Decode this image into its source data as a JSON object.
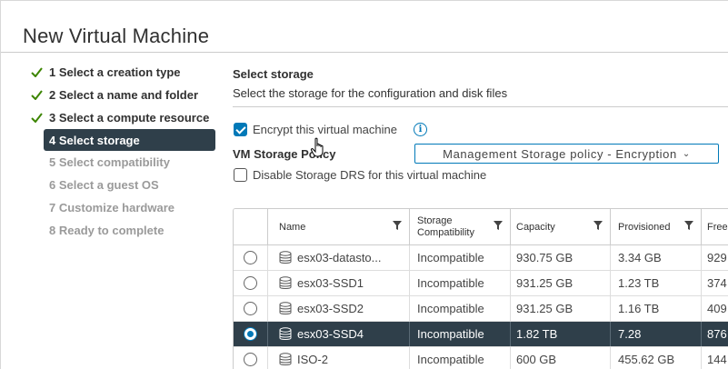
{
  "dialog": {
    "title": "New Virtual Machine"
  },
  "steps": [
    {
      "label": "1 Select a creation type",
      "state": "done"
    },
    {
      "label": "2 Select a name and folder",
      "state": "done"
    },
    {
      "label": "3 Select a compute resource",
      "state": "done"
    },
    {
      "label": "4 Select storage",
      "state": "active"
    },
    {
      "label": "5 Select compatibility",
      "state": "pending"
    },
    {
      "label": "6 Select a guest OS",
      "state": "pending"
    },
    {
      "label": "7 Customize hardware",
      "state": "pending"
    },
    {
      "label": "8 Ready to complete",
      "state": "pending"
    }
  ],
  "storage": {
    "title": "Select storage",
    "description": "Select the storage for the configuration and disk files",
    "encrypt_label": "Encrypt this virtual machine",
    "encrypt_checked": true,
    "policy_label": "VM Storage Policy",
    "policy_value": "Management Storage policy - Encryption",
    "disable_drs_label": "Disable Storage DRS for this virtual machine",
    "disable_drs_checked": false
  },
  "table": {
    "columns": {
      "name": "Name",
      "compat_line1": "Storage",
      "compat_line2": "Compatibility",
      "capacity": "Capacity",
      "provisioned": "Provisioned",
      "free": "Free"
    },
    "rows": [
      {
        "name": "esx03-datasto...",
        "compat": "Incompatible",
        "capacity": "930.75 GB",
        "provisioned": "3.34 GB",
        "free": "929",
        "selected": false
      },
      {
        "name": "esx03-SSD1",
        "compat": "Incompatible",
        "capacity": "931.25 GB",
        "provisioned": "1.23 TB",
        "free": "374",
        "selected": false
      },
      {
        "name": "esx03-SSD2",
        "compat": "Incompatible",
        "capacity": "931.25 GB",
        "provisioned": "1.16 TB",
        "free": "409",
        "selected": false
      },
      {
        "name": "esx03-SSD4",
        "compat": "Incompatible",
        "capacity": "1.82 TB",
        "provisioned": "7.28",
        "free": "876",
        "selected": true
      },
      {
        "name": "ISO-2",
        "compat": "Incompatible",
        "capacity": "600 GB",
        "provisioned": "455.62 GB",
        "free": "144",
        "selected": false
      }
    ]
  },
  "colors": {
    "accent": "#0079b8",
    "selected_row": "#2f3f4a",
    "check_green": "#3c8500"
  }
}
